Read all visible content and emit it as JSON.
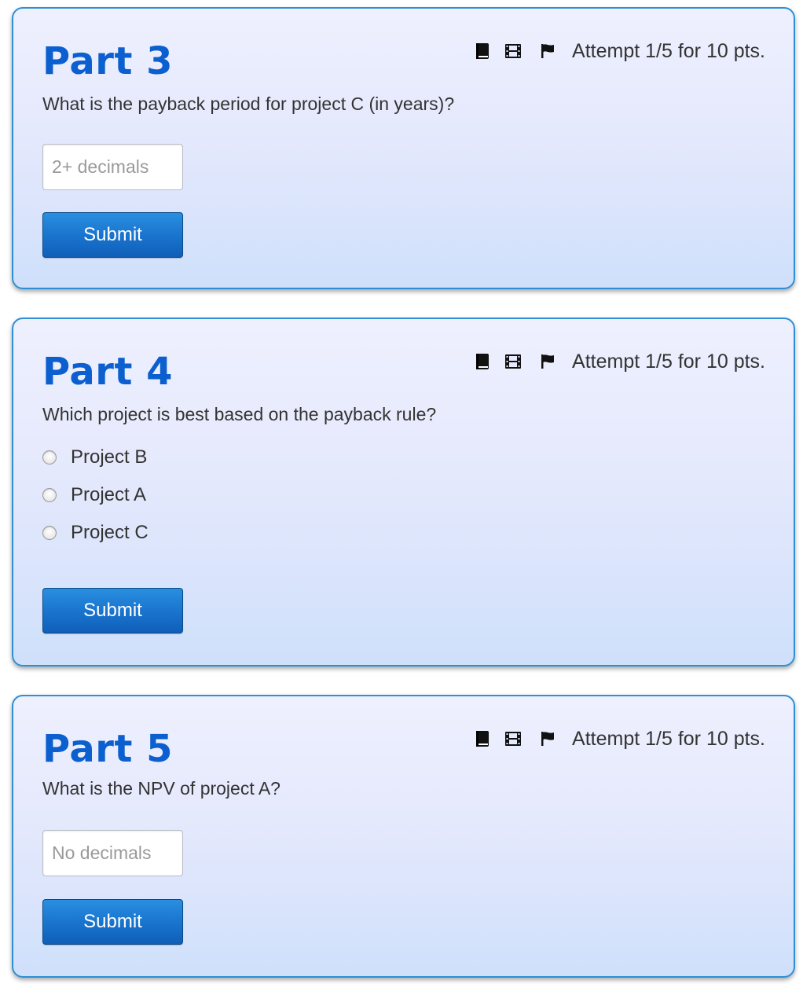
{
  "parts": [
    {
      "title": "Part 3",
      "attempt": "Attempt 1/5 for 10 pts.",
      "question": "What is the payback period for project C (in years)?",
      "input_placeholder": "2+ decimals",
      "input_value": "",
      "submit_label": "Submit"
    },
    {
      "title": "Part 4",
      "attempt": "Attempt 1/5 for 10 pts.",
      "question": "Which project is best based on the payback rule?",
      "options": [
        "Project B",
        "Project A",
        "Project C"
      ],
      "selected_option": null,
      "submit_label": "Submit"
    },
    {
      "title": "Part 5",
      "attempt": "Attempt 1/5 for 10 pts.",
      "question": "What is the NPV of project A?",
      "input_placeholder": "No decimals",
      "input_value": "",
      "submit_label": "Submit"
    }
  ],
  "icons": {
    "toolbar": [
      "book-icon",
      "film-icon",
      "flag-icon"
    ]
  },
  "colors": {
    "title": "#0b5fcf",
    "card_border": "#2f8fd6",
    "button": "#1a75cf",
    "text": "#333333"
  }
}
